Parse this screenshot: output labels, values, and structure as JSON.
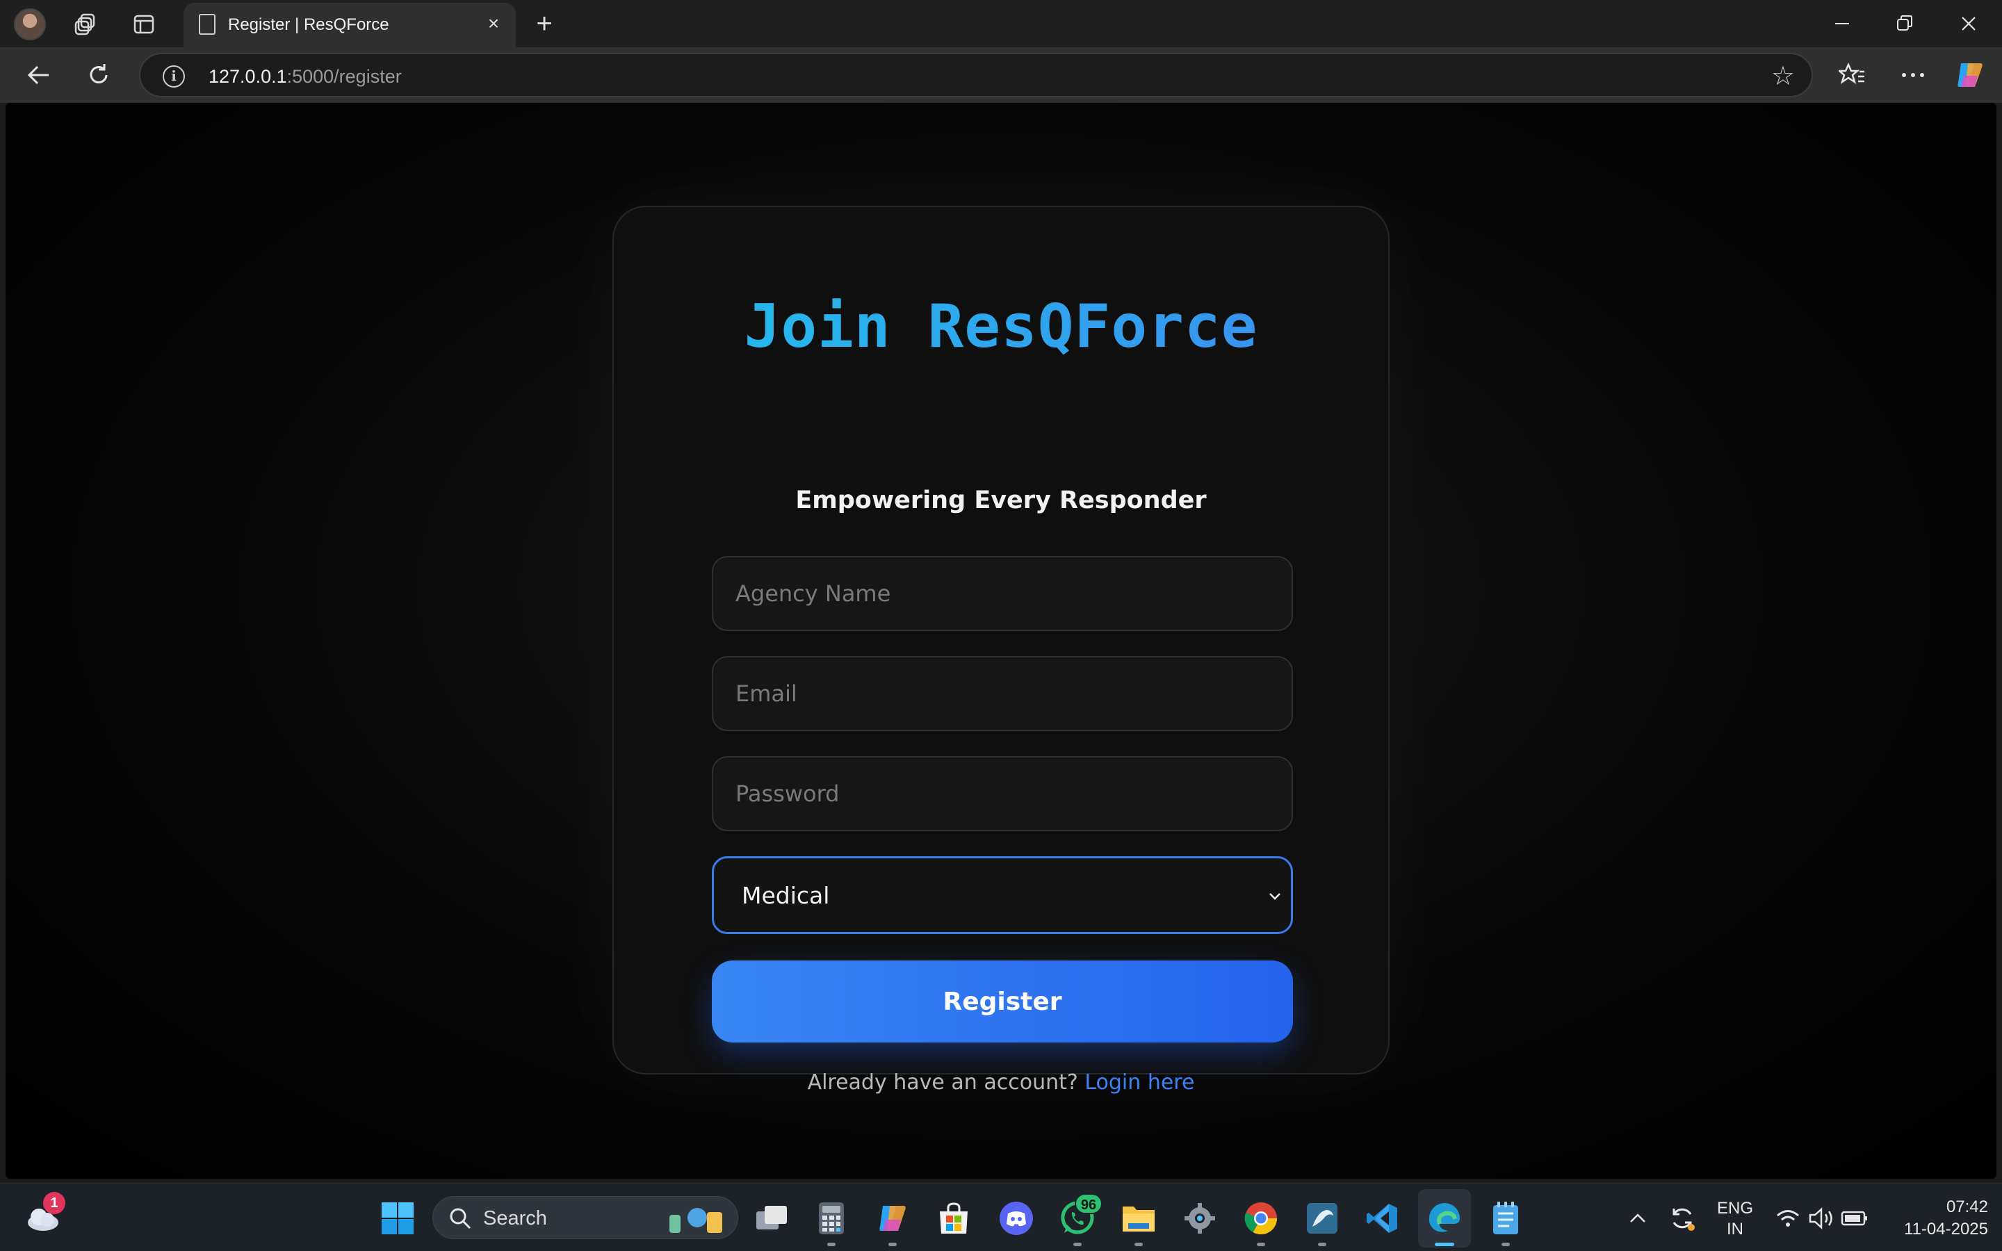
{
  "browser": {
    "tab_title": "Register | ResQForce",
    "url_host": "127.0.0.1",
    "url_path": ":5000/register"
  },
  "page": {
    "title": "Join ResQForce",
    "subtitle": "Empowering Every Responder",
    "agency_placeholder": "Agency Name",
    "email_placeholder": "Email",
    "password_placeholder": "Password",
    "category_selected": "Medical",
    "register_label": "Register",
    "footer_text": "Already have an account?",
    "login_link": "Login here"
  },
  "taskbar": {
    "search_label": "Search",
    "weather_badge": "1",
    "whatsapp_badge": "96",
    "lang_top": "ENG",
    "lang_bottom": "IN",
    "time": "07:42",
    "date": "11-04-2025"
  },
  "colors": {
    "accent_blue": "#3b82f6",
    "title_gradient_start": "#22c0ea",
    "title_gradient_end": "#3b8cf0"
  }
}
